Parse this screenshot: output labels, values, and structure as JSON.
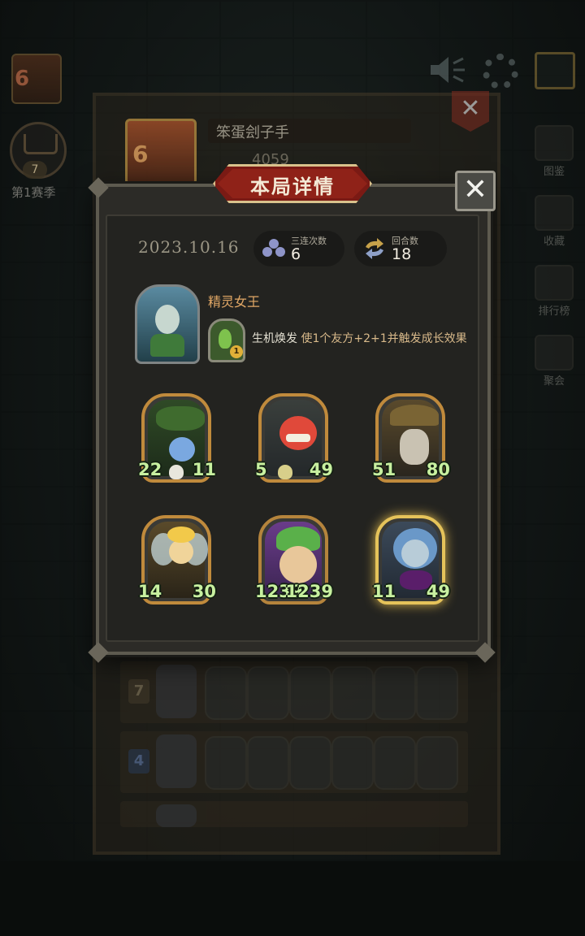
{
  "background": {
    "season_number": "7",
    "season_label": "第1赛季",
    "profile": {
      "avatar_level": "6",
      "player_name": "笨蛋刽子手",
      "score": "4059"
    },
    "side_menu": [
      {
        "label": "图鉴"
      },
      {
        "label": "收藏"
      },
      {
        "label": "排行榜"
      },
      {
        "label": "聚会"
      }
    ],
    "rows": [
      {
        "rank": "7",
        "rank_color": "#9a8a6a"
      },
      {
        "rank": "4",
        "rank_color": "#6a8ac2"
      },
      {
        "rank": "",
        "rank_color": "#9a8a6a"
      }
    ]
  },
  "dialog": {
    "title": "本局详情",
    "close_label": "✕",
    "date": "2023.10.16",
    "triples": {
      "label": "三连次数",
      "value": "6"
    },
    "rounds": {
      "label": "回合数",
      "value": "18"
    },
    "hero": {
      "name": "精灵女王",
      "skill_name": "生机焕发",
      "skill_desc": "使1个友方+2+1并触发成长效果",
      "skill_level": "1"
    },
    "cards": [
      {
        "attack": "22",
        "health": "11",
        "art": "vine-flower",
        "skull": true
      },
      {
        "attack": "5",
        "health": "49",
        "art": "red-demon",
        "skull": true
      },
      {
        "attack": "51",
        "health": "80",
        "art": "witch",
        "skull": false
      },
      {
        "attack": "14",
        "health": "30",
        "art": "fairy",
        "skull": false
      },
      {
        "attack": "1239",
        "health": "1239",
        "art": "sprout-kid",
        "skull": false
      },
      {
        "attack": "11",
        "health": "49",
        "art": "dark-elf",
        "skull": false
      }
    ]
  },
  "colors": {
    "accent_gold": "#c08a3c",
    "banner_red": "#8f2218",
    "stat_green": "#c8f0a0"
  }
}
